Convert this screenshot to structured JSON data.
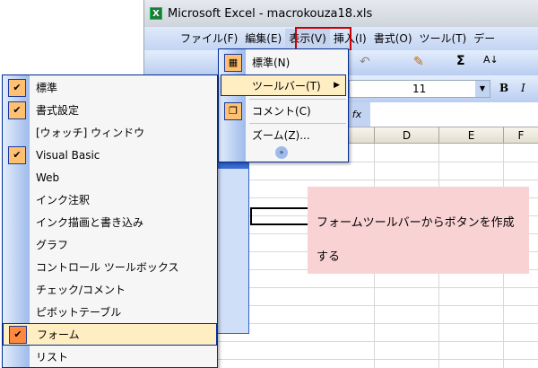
{
  "window": {
    "title": "Microsoft Excel - macrokouza18.xls",
    "app_icon": "excel-icon"
  },
  "menubar": [
    "ファイル(F)",
    "編集(E)",
    "表示(V)",
    "挿入(I)",
    "書式(O)",
    "ツール(T)",
    "デー"
  ],
  "format": {
    "font_size": "11",
    "bold": "B",
    "italic": "I",
    "fx": "fx"
  },
  "columns": [
    "D",
    "E",
    "F"
  ],
  "view_menu": {
    "items": [
      {
        "label": "標準(N)",
        "icon": "grid-icon"
      },
      {
        "label": "ツールバー(T)",
        "highlighted": true,
        "submenu": true
      },
      {
        "label": "コメント(C)",
        "icon": "comment-icon"
      },
      {
        "label": "ズーム(Z)..."
      }
    ],
    "expand": "chevron-double-down-icon"
  },
  "toolbar_menu": {
    "items": [
      {
        "label": "標準",
        "checked": true
      },
      {
        "label": "書式設定",
        "checked": true
      },
      {
        "label": "[ウォッチ] ウィンドウ",
        "checked": false
      },
      {
        "label": "Visual Basic",
        "checked": true
      },
      {
        "label": "Web",
        "checked": false
      },
      {
        "label": "インク注釈",
        "checked": false
      },
      {
        "label": "インク描画と書き込み",
        "checked": false
      },
      {
        "label": "グラフ",
        "checked": false
      },
      {
        "label": "コントロール ツールボックス",
        "checked": false
      },
      {
        "label": "チェック/コメント",
        "checked": false
      },
      {
        "label": "ピボットテーブル",
        "checked": false
      },
      {
        "label": "フォーム",
        "checked": true,
        "highlighted": true
      },
      {
        "label": "リスト",
        "checked": false
      }
    ]
  },
  "callout": {
    "text": "フォームツールバーからボタンを作成する"
  },
  "colors": {
    "highlight_border": "#cc0000",
    "menu_highlight": "#ffeec2",
    "callout_bg": "#f9d2d4"
  }
}
